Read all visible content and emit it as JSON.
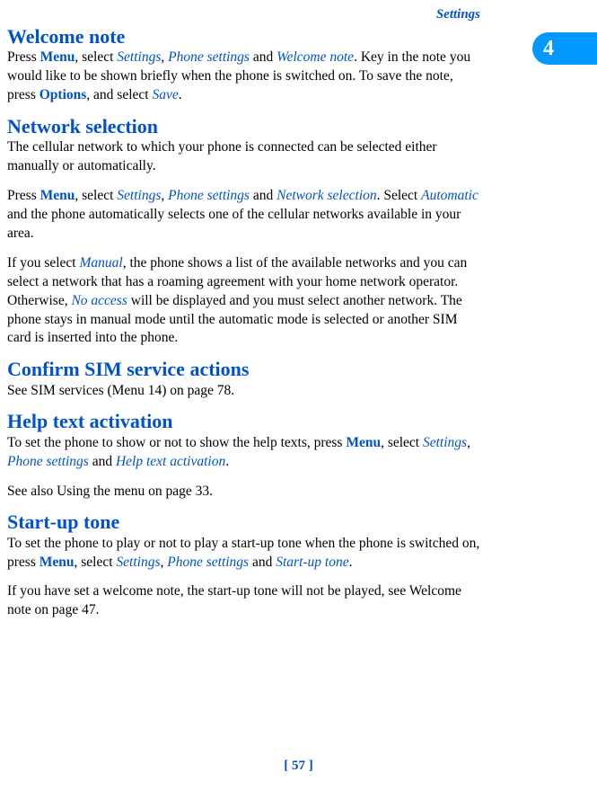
{
  "header": {
    "section_label": "Settings",
    "chapter_number": "4"
  },
  "sections": {
    "welcome": {
      "title": "Welcome note",
      "p1_a": "Press ",
      "p1_menu": "Menu",
      "p1_b": ", select ",
      "p1_settings": "Settings",
      "p1_c": ", ",
      "p1_phone": "Phone settings",
      "p1_d": " and ",
      "p1_welcome": "Welcome note",
      "p1_e": ". Key in the note you would like to be shown briefly when the phone is switched on. To save the note, press ",
      "p1_options": "Options",
      "p1_f": ", and select ",
      "p1_save": "Save",
      "p1_g": "."
    },
    "network": {
      "title": "Network selection",
      "p1": "The cellular network to which your phone is connected can be selected either manually or automatically.",
      "p2_a": "Press ",
      "p2_menu": "Menu",
      "p2_b": ", select ",
      "p2_settings": "Settings",
      "p2_c": ", ",
      "p2_phone": "Phone settings",
      "p2_d": " and ",
      "p2_netsel": "Network selection",
      "p2_e": ". Select ",
      "p2_auto": "Automatic",
      "p2_f": " and the phone automatically selects one of the cellular networks available in your area.",
      "p3_a": "If you select ",
      "p3_manual": "Manual",
      "p3_b": ", the phone shows a list of the available networks and you can select a network that has a roaming agreement with your home network operator. Otherwise, ",
      "p3_noaccess": "No access",
      "p3_c": " will be displayed and you must select another network. The phone stays in manual mode until the automatic mode is selected or another SIM card is inserted into the phone."
    },
    "confirm": {
      "title": "Confirm SIM service actions",
      "p1": "See SIM services (Menu 14) on page 78."
    },
    "help": {
      "title": "Help text activation",
      "p1_a": "To set the phone to show or not to show the help texts, press ",
      "p1_menu": "Menu",
      "p1_b": ", select ",
      "p1_settings": "Settings",
      "p1_c": ", ",
      "p1_phone": "Phone settings",
      "p1_d": " and ",
      "p1_help": "Help text activation",
      "p1_e": ".",
      "p2": "See also Using the menu on page 33."
    },
    "startup": {
      "title": "Start-up tone",
      "p1_a": "To set the phone to play or not to play a start-up tone when the phone is switched on, press ",
      "p1_menu": "Menu",
      "p1_b": ", select ",
      "p1_settings": "Settings",
      "p1_c": ", ",
      "p1_phone": "Phone settings",
      "p1_d": " and ",
      "p1_startup": "Start-up tone",
      "p1_e": ".",
      "p2": "If you have set a welcome note, the start-up tone will not be played, see Welcome note on page 47."
    }
  },
  "footer": {
    "page": "[ 57 ]"
  }
}
